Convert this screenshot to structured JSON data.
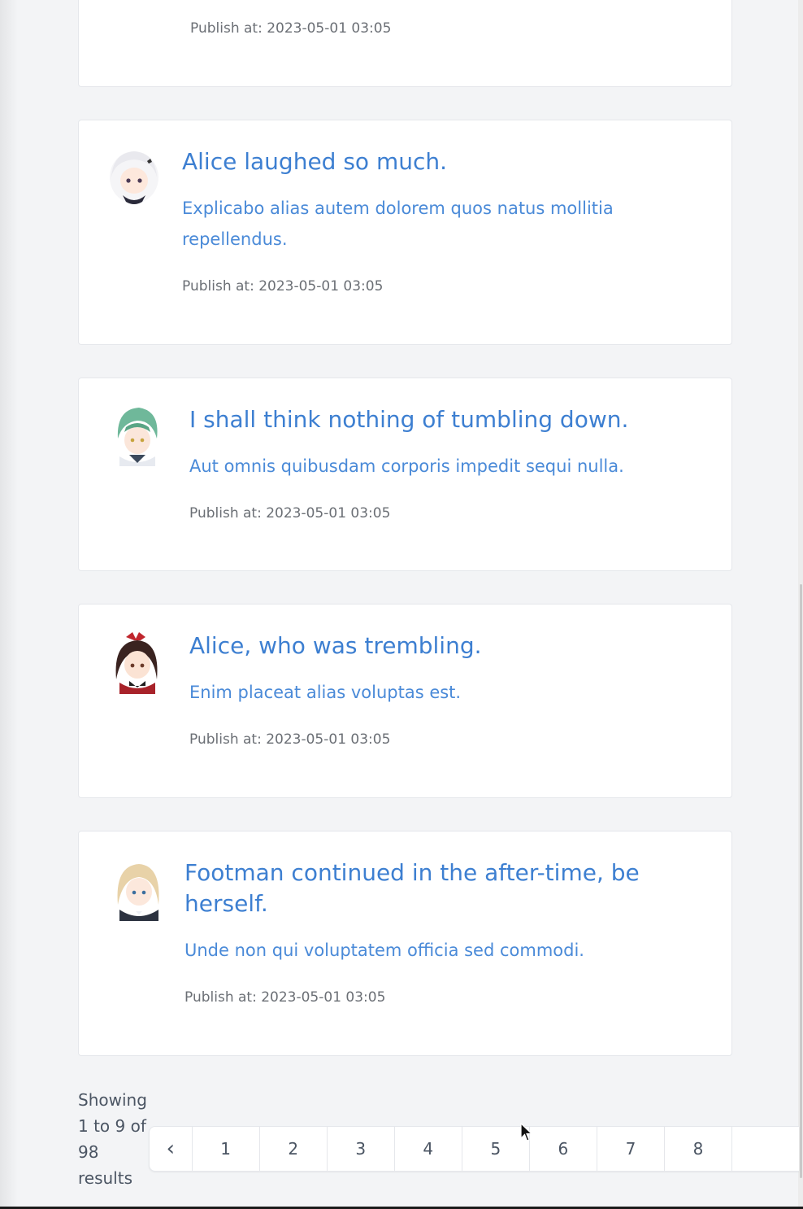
{
  "posts": [
    {
      "title": "",
      "body": "",
      "meta": "Publish at: 2023-05-01 03:05"
    },
    {
      "title": "Alice laughed so much.",
      "body": "Explicabo alias autem dolorem quos natus mollitia repellendus.",
      "meta": "Publish at: 2023-05-01 03:05"
    },
    {
      "title": "I shall think nothing of tumbling down.",
      "body": "Aut omnis quibusdam corporis impedit sequi nulla.",
      "meta": "Publish at: 2023-05-01 03:05"
    },
    {
      "title": "Alice, who was trembling.",
      "body": "Enim placeat alias voluptas est.",
      "meta": "Publish at: 2023-05-01 03:05"
    },
    {
      "title": "Footman continued in the after-time, be herself.",
      "body": "Unde non qui voluptatem officia sed commodi.",
      "meta": "Publish at: 2023-05-01 03:05"
    }
  ],
  "pagination": {
    "summary": "Showing 1 to 9 of 98 results",
    "prev_label": "‹",
    "pages": [
      "1",
      "2",
      "3",
      "4",
      "5",
      "6",
      "7",
      "8"
    ],
    "hovered_page": "5"
  },
  "icons": {
    "prev": "chevron-left-icon",
    "cursor": "mouse-pointer-icon"
  },
  "colors": {
    "title": "#3d7fd1",
    "body": "#4a8ad8",
    "meta": "#6b6f75",
    "background": "#f3f4f6",
    "card": "#ffffff"
  }
}
